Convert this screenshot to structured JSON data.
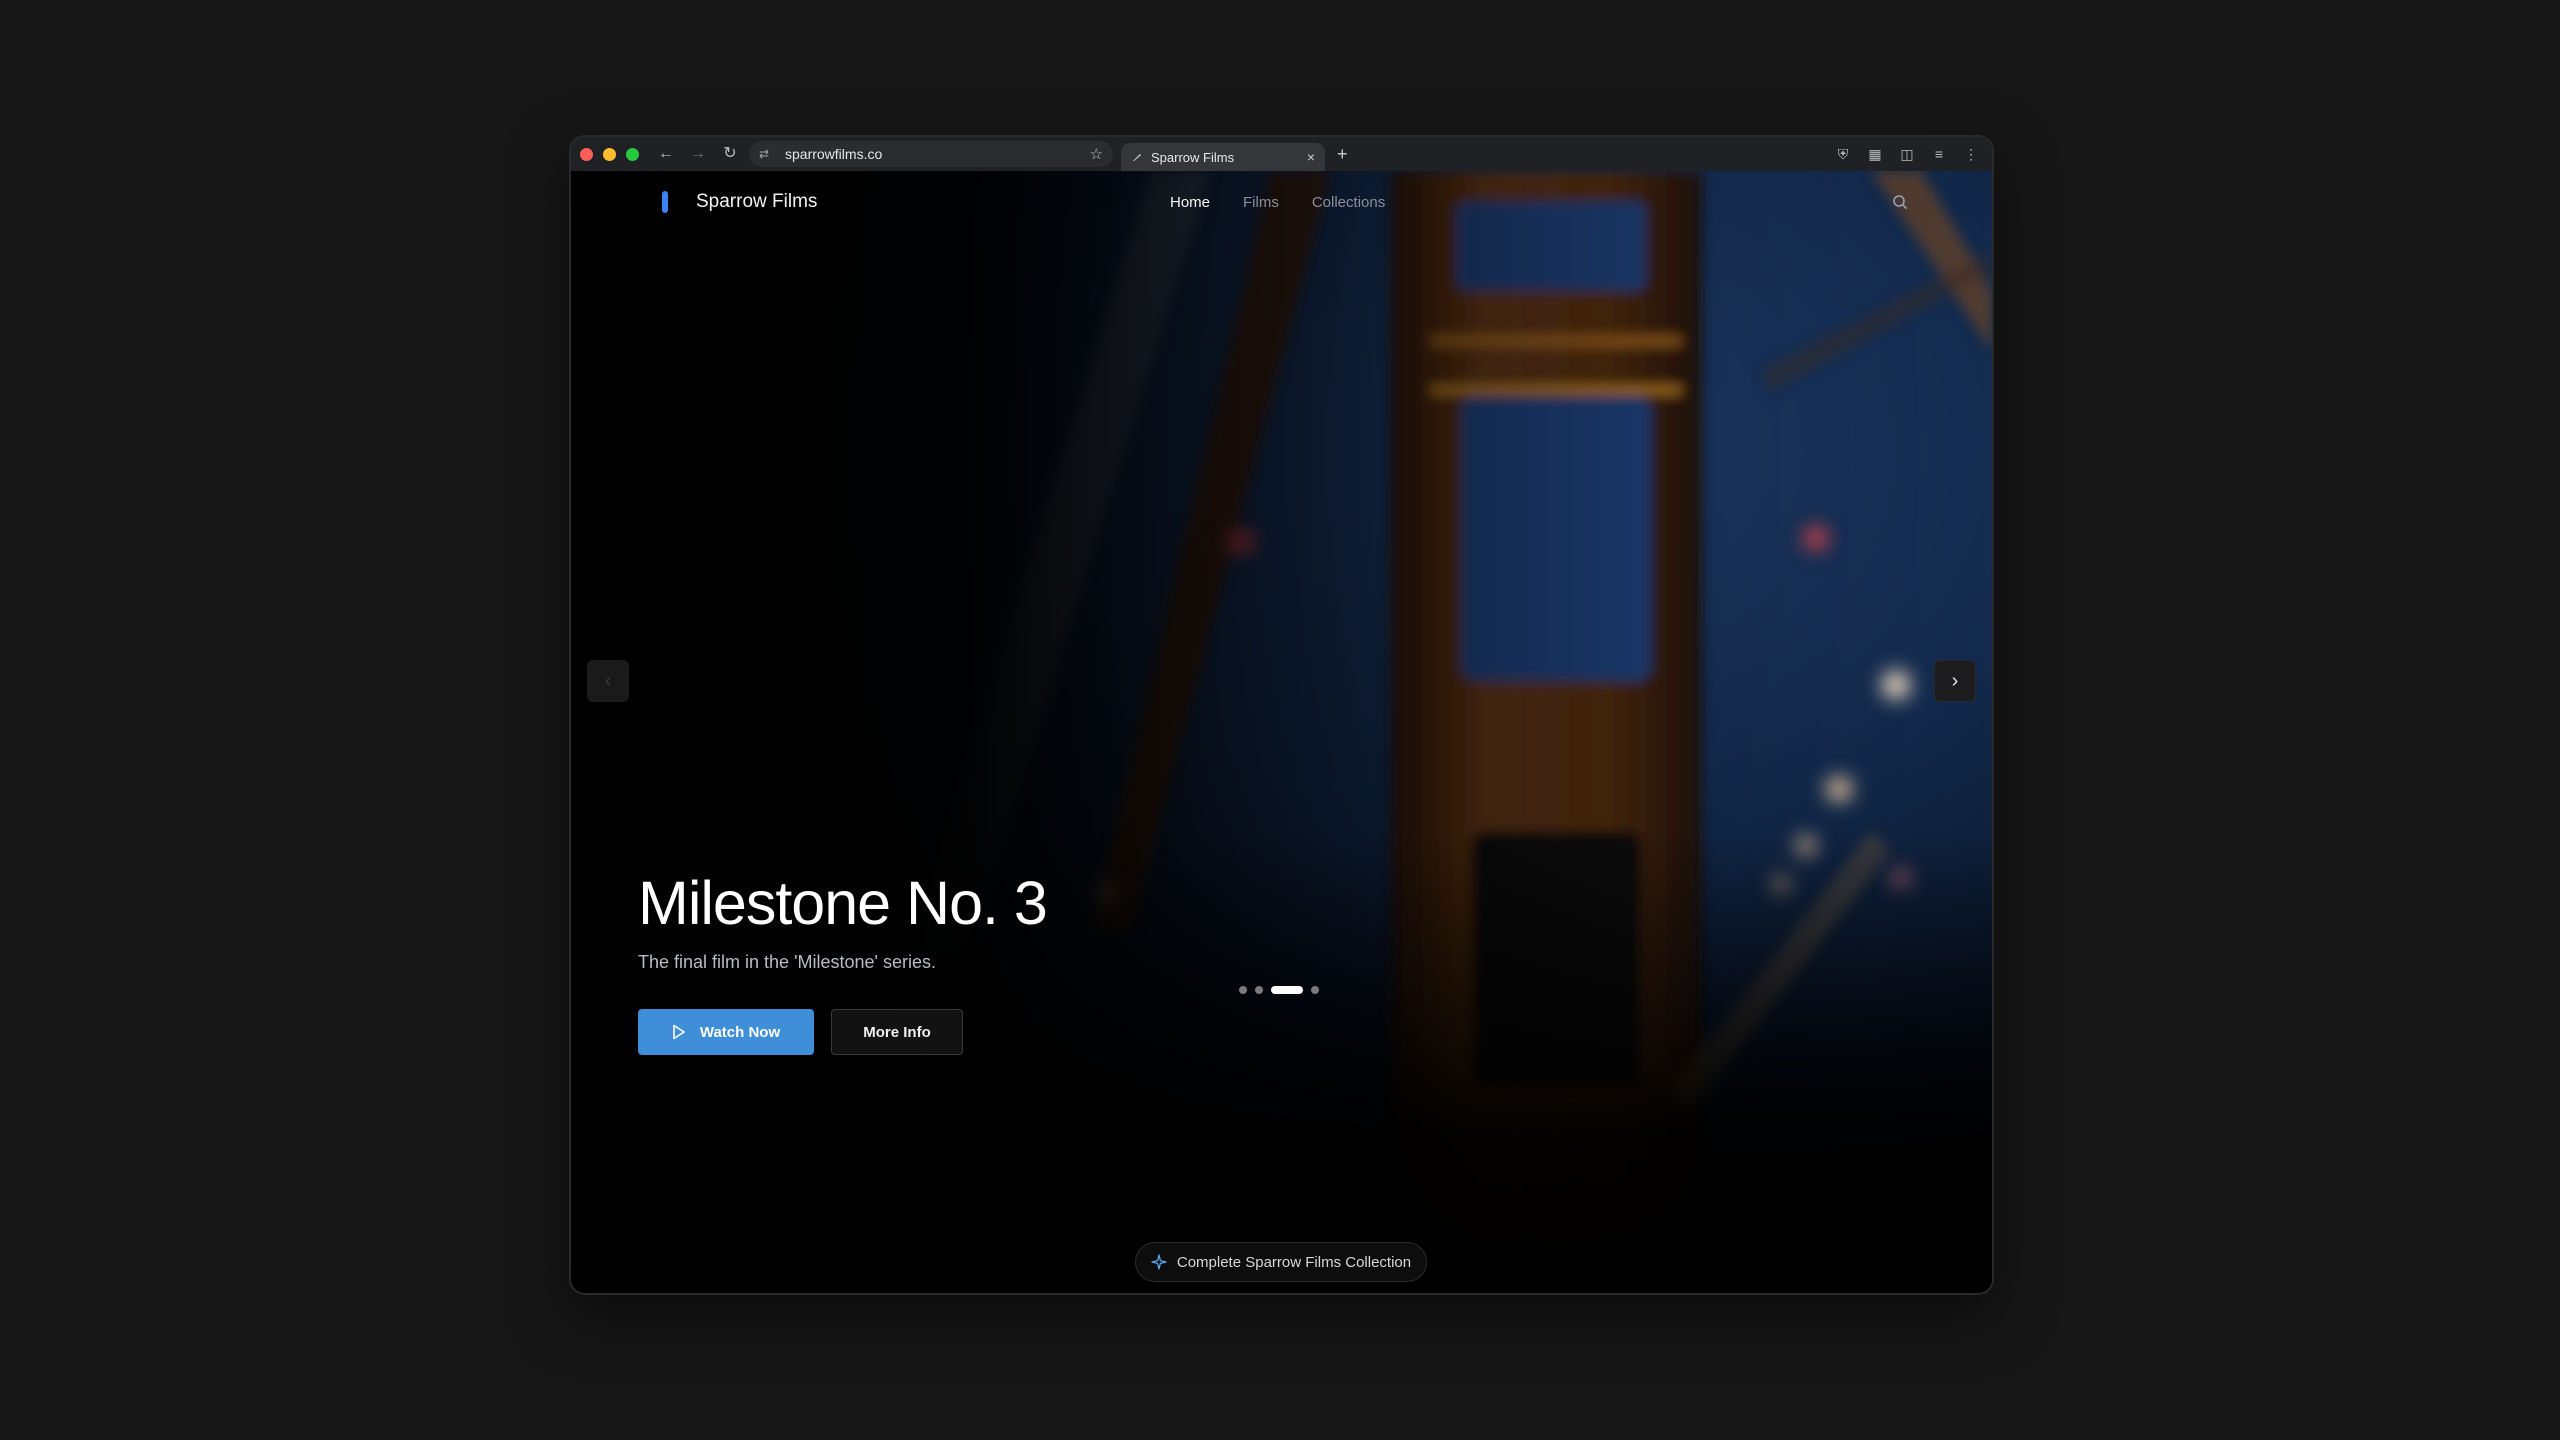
{
  "browser": {
    "url": "sparrowfilms.co",
    "tab_title": "Sparrow Films",
    "tab_close": "×",
    "new_tab": "+"
  },
  "site": {
    "brand": "Sparrow Films",
    "accent_color": "#3b82f6",
    "nav": [
      {
        "label": "Home",
        "active": true
      },
      {
        "label": "Films",
        "active": false
      },
      {
        "label": "Collections",
        "active": false
      }
    ]
  },
  "hero": {
    "title": "Milestone No. 3",
    "subtitle": "The final film in the 'Milestone' series.",
    "watch_label": "Watch Now",
    "info_label": "More Info",
    "slide_count": 4,
    "active_slide": 3
  },
  "footer_chip": {
    "label": "Complete Sparrow Films Collection"
  },
  "icons": [
    "back-icon",
    "forward-icon",
    "reload-icon",
    "site-settings-icon",
    "bookmark-star-icon",
    "search-icon",
    "chevron-left-icon",
    "chevron-right-icon",
    "play-icon",
    "sparkle-icon",
    "shield-icon",
    "extension-icon",
    "puzzle-icon",
    "media-icon",
    "menu-icon"
  ]
}
